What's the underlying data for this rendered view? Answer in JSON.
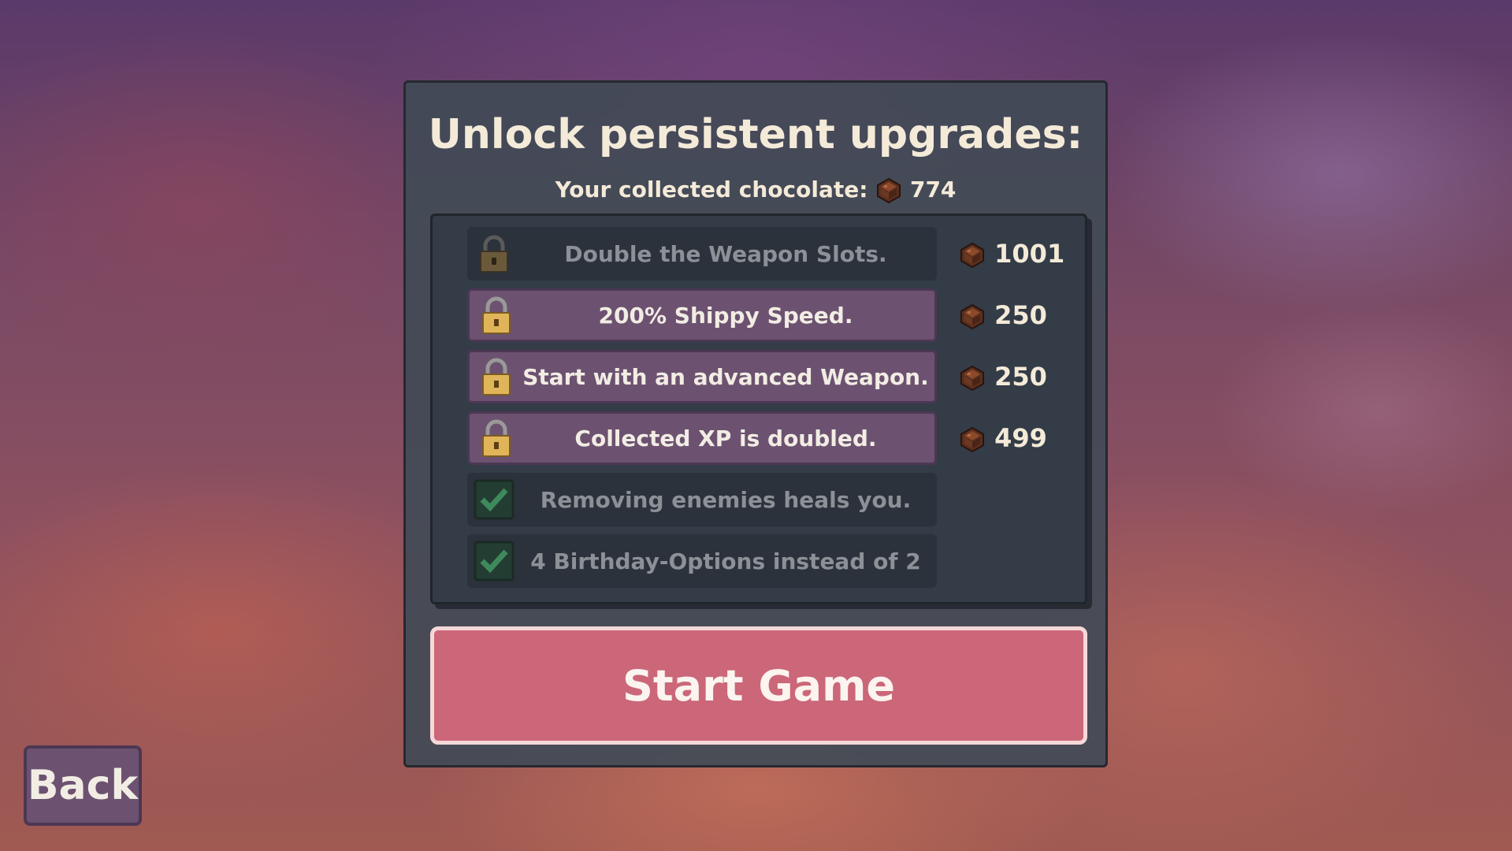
{
  "panel": {
    "title": "Unlock persistent upgrades:",
    "chocolate_label": "Your collected chocolate:",
    "chocolate_amount": "774",
    "chocolate_icon": "chocolate-icon"
  },
  "upgrades": [
    {
      "label": "Double the Weapon Slots.",
      "price": "1001",
      "state": "locked-unaffordable",
      "icon": "lock-icon"
    },
    {
      "label": "200% Shippy Speed.",
      "price": "250",
      "state": "locked-affordable",
      "icon": "lock-icon"
    },
    {
      "label": "Start with an advanced Weapon.",
      "price": "250",
      "state": "locked-affordable",
      "icon": "lock-icon"
    },
    {
      "label": "Collected XP is doubled.",
      "price": "499",
      "state": "locked-affordable",
      "icon": "lock-icon"
    },
    {
      "label": "Removing enemies heals you.",
      "state": "unlocked",
      "icon": "checkmark-icon"
    },
    {
      "label": "4 Birthday-Options instead of 2",
      "state": "unlocked",
      "icon": "checkmark-icon"
    }
  ],
  "buttons": {
    "start": "Start Game",
    "back": "Back"
  },
  "colors": {
    "panel": "#424a56",
    "row_purchasable": "#6c5270",
    "row_inactive": "#2b323b",
    "start_button": "#cb6779",
    "text_light": "#f4ead8"
  }
}
